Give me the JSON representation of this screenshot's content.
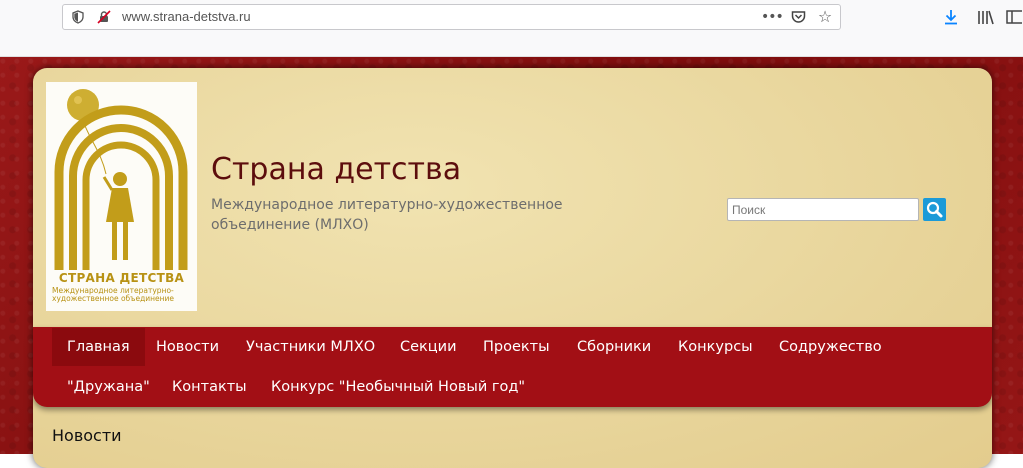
{
  "browser": {
    "url": "www.strana-detstva.ru",
    "icons": [
      "shield-icon",
      "insecure-lock-icon",
      "more-icon",
      "pocket-icon",
      "bookmark-star-icon",
      "download-icon",
      "library-icon",
      "sidebar-icon"
    ]
  },
  "header": {
    "logo": {
      "title": "СТРАНА ДЕТСТВА",
      "subtitle": "Международное литературно-художественное объединение"
    },
    "site_title": "Страна детства",
    "site_description": "Международное литературно-художественное объединение (МЛХО)"
  },
  "search": {
    "placeholder": "Поиск"
  },
  "nav": {
    "items": [
      {
        "label": "Главная",
        "active": true
      },
      {
        "label": "Новости"
      },
      {
        "label": "Участники МЛХО"
      },
      {
        "label": "Секции"
      },
      {
        "label": "Проекты"
      },
      {
        "label": "Сборники"
      },
      {
        "label": "Конкурсы"
      },
      {
        "label": "Содружество"
      },
      {
        "label": "\"Дружана\""
      },
      {
        "label": "Контакты"
      },
      {
        "label": "Конкурс \"Необычный Новый год\""
      }
    ]
  },
  "main": {
    "section_title": "Новости"
  },
  "colors": {
    "nav_bg": "#a20f15",
    "nav_active": "#8b0a0e",
    "page_bg": "#8f1414",
    "parchment": "#ecdca5",
    "title": "#5c0d0d",
    "gold": "#b89214",
    "search_button": "#1b9ad8"
  }
}
